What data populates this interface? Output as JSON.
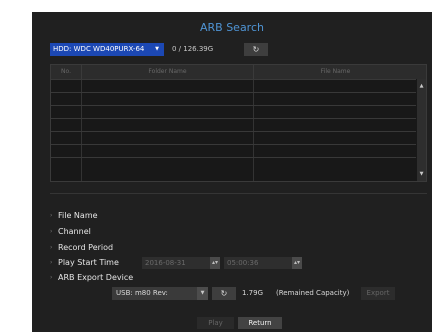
{
  "title": "ARB Search",
  "hdd": {
    "selected": "HDD: WDC WD40PURX-64",
    "capacity": "0 / 126.39G",
    "refresh_icon": "refresh-icon"
  },
  "table": {
    "columns": [
      "No.",
      "Folder Name",
      "File Name"
    ],
    "rows": [],
    "empty_row_count": 7
  },
  "options": {
    "file_name": "File Name",
    "channel": "Channel",
    "record_period": "Record Period",
    "play_start_time": "Play Start Time",
    "start_date": "2016-08-31",
    "start_time": "05:00:36"
  },
  "export": {
    "label": "ARB Export Device",
    "device": "USB: m80 Rev:",
    "remained": "1.79G",
    "remained_label": "(Remained Capacity)",
    "export_button": "Export"
  },
  "buttons": {
    "play": "Play",
    "return": "Return"
  },
  "colors": {
    "title": "#4f94d4",
    "hdd_select": "#1c48b4",
    "background": "#202020"
  }
}
